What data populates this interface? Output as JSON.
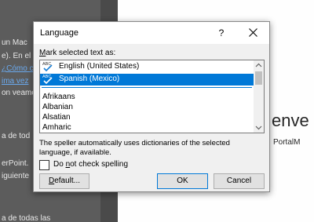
{
  "background": {
    "left_lines": [
      "un Mac",
      "e). En el",
      "¿Cómo c",
      "ima vez",
      "on veamo",
      "a de tod",
      "erPoint.",
      "iguiente",
      "a de todas las"
    ],
    "heading_fragment": "enve",
    "subtitle_fragment": "PortalM"
  },
  "dialog": {
    "title": "Language",
    "help_label": "?",
    "mark_label_u": "M",
    "mark_label_rest": "ark selected text as:",
    "recent_languages": [
      {
        "label": "English (United States)",
        "icon": "abc-spellcheck-icon"
      },
      {
        "label": "Spanish (Mexico)",
        "icon": "abc-spellcheck-icon",
        "selected": true
      }
    ],
    "languages": [
      "Afrikaans",
      "Albanian",
      "Alsatian",
      "Amharic"
    ],
    "info_text": "The speller automatically uses dictionaries of the selected language, if available.",
    "checkbox": {
      "before": "Do ",
      "underlined": "n",
      "after": "ot check spelling",
      "checked": false
    },
    "buttons": {
      "default_u": "D",
      "default_rest": "efault...",
      "ok": "OK",
      "cancel": "Cancel"
    }
  },
  "colors": {
    "selection": "#0078d7",
    "dialog_bg": "#f0f0f0"
  }
}
